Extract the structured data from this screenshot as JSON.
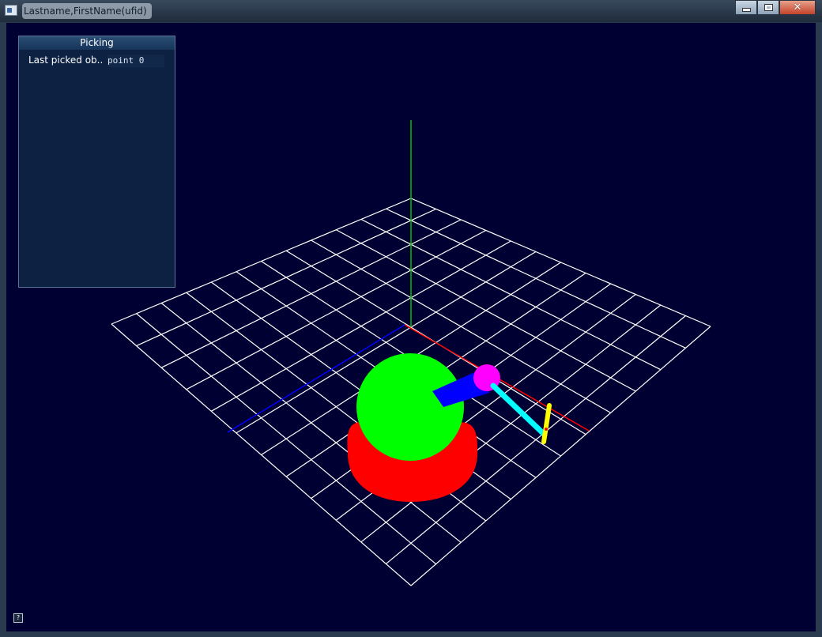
{
  "window": {
    "title": "Lastname,FirstName(ufid)",
    "buttons": {
      "minimize_icon": "minimize-icon",
      "maximize_icon": "maximize-icon",
      "close_icon": "close-icon",
      "close_glyph": "✕"
    }
  },
  "panel": {
    "title": "Picking",
    "row_label": "Last picked ob..",
    "row_value": "point 0"
  },
  "help": {
    "glyph": "?"
  },
  "colors": {
    "background": "#000033",
    "grid": "#ffffff",
    "y_axis": "#00c000",
    "x_axis": "#ff0000",
    "z_axis": "#0000ff",
    "base": "#ff0000",
    "body": "#00ff00",
    "upper_arm": "#0000ff",
    "joint": "#ff00ff",
    "forearm": "#00ffff",
    "end_effector": "#ffff00"
  }
}
